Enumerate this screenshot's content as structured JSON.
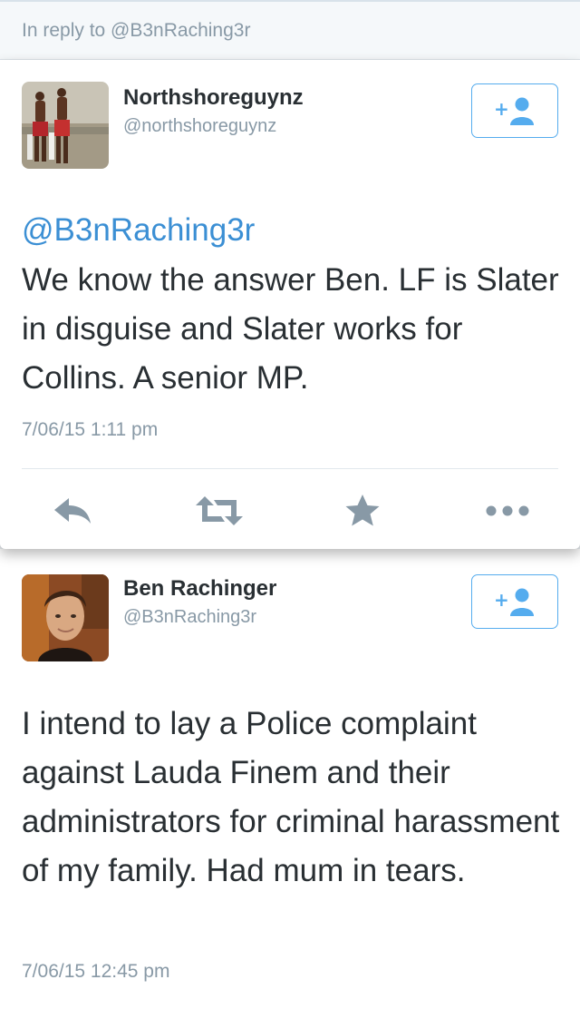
{
  "reply_context": {
    "text": "In reply to @B3nRaching3r"
  },
  "focused_tweet": {
    "display_name": "Northshoreguynz",
    "handle": "@northshoreguynz",
    "mention": "@B3nRaching3r",
    "text": "We know the answer Ben. LF is Slater in disguise and Slater works for Collins. A senior MP.",
    "timestamp": "7/06/15 1:11 pm",
    "follow_icon": "add-user-icon",
    "actions": [
      "reply-icon",
      "retweet-icon",
      "favorite-star-icon",
      "more-icon"
    ]
  },
  "reply_tweet": {
    "display_name": "Ben Rachinger",
    "handle": "@B3nRaching3r",
    "text": "I intend to lay a Police complaint against Lauda Finem and their administrators for criminal harassment of my family. Had mum in tears.",
    "timestamp": "7/06/15 12:45 pm",
    "follow_icon": "add-user-icon"
  },
  "colors": {
    "accent": "#55acee",
    "mention": "#3b8fd4",
    "icon_gray": "#8899a6",
    "text": "#292f33",
    "muted_bg": "#f5f8fa"
  }
}
